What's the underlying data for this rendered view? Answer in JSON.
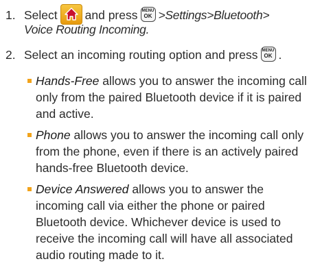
{
  "step1": {
    "number": "1.",
    "select": "Select",
    "and_press": "and press",
    "path1": ">Settings>Bluetooth>",
    "path2": "Voice Routing Incoming."
  },
  "step2": {
    "number": "2.",
    "text": "Select an incoming routing option and press"
  },
  "menu_key": {
    "top": "MENU",
    "bottom": "OK"
  },
  "bullets": [
    {
      "term": "Hands-Free",
      "lines": [
        "allows you to answer the incoming call",
        "only from the paired Bluetooth device if it is paired",
        "and active."
      ]
    },
    {
      "term": "Phone",
      "lines": [
        "allows you to answer the incoming call only",
        "from the phone, even if there is an actively paired",
        "hands-free Bluetooth device."
      ]
    },
    {
      "term": "Device Answered",
      "lines": [
        "allows you to answer the",
        "incoming call via either the phone or paired",
        "Bluetooth device. Whichever device is used to",
        "receive the incoming call will have all associated",
        "audio routing made to it."
      ]
    }
  ],
  "colors": {
    "bullet": "#f2a31b",
    "home_button": "#f0b02a",
    "text": "#2b2b2b"
  },
  "icons": {
    "home": "home-icon",
    "menu_ok": "menu-ok-key-icon"
  }
}
